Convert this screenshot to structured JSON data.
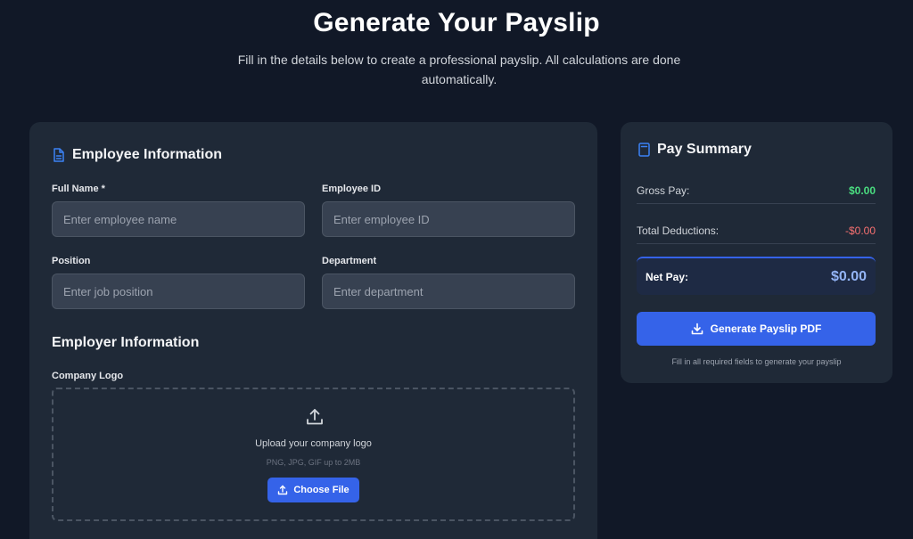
{
  "header": {
    "title": "Generate Your Payslip",
    "subtitle": "Fill in the details below to create a professional payslip. All calculations are done automatically."
  },
  "employee": {
    "section_title": "Employee Information",
    "full_name": {
      "label": "Full Name *",
      "placeholder": "Enter employee name",
      "value": ""
    },
    "employee_id": {
      "label": "Employee ID",
      "placeholder": "Enter employee ID",
      "value": ""
    },
    "position": {
      "label": "Position",
      "placeholder": "Enter job position",
      "value": ""
    },
    "department": {
      "label": "Department",
      "placeholder": "Enter department",
      "value": ""
    }
  },
  "employer": {
    "section_title": "Employer Information",
    "logo_label": "Company Logo",
    "upload_text": "Upload your company logo",
    "upload_hint": "PNG, JPG, GIF up to 2MB",
    "choose_file_label": "Choose File"
  },
  "summary": {
    "title": "Pay Summary",
    "gross_label": "Gross Pay:",
    "gross_value": "$0.00",
    "deductions_label": "Total Deductions:",
    "deductions_value": "-$0.00",
    "net_label": "Net Pay:",
    "net_value": "$0.00",
    "generate_label": "Generate Payslip PDF",
    "generate_hint": "Fill in all required fields to generate your payslip"
  },
  "icons": {
    "employee_section": "document-icon",
    "summary_section": "calculator-icon",
    "upload": "upload-icon",
    "download": "download-icon"
  },
  "colors": {
    "background": "#111827",
    "card": "#1f2937",
    "accent": "#3563e9",
    "positive": "#4ade80",
    "negative": "#f87171"
  }
}
